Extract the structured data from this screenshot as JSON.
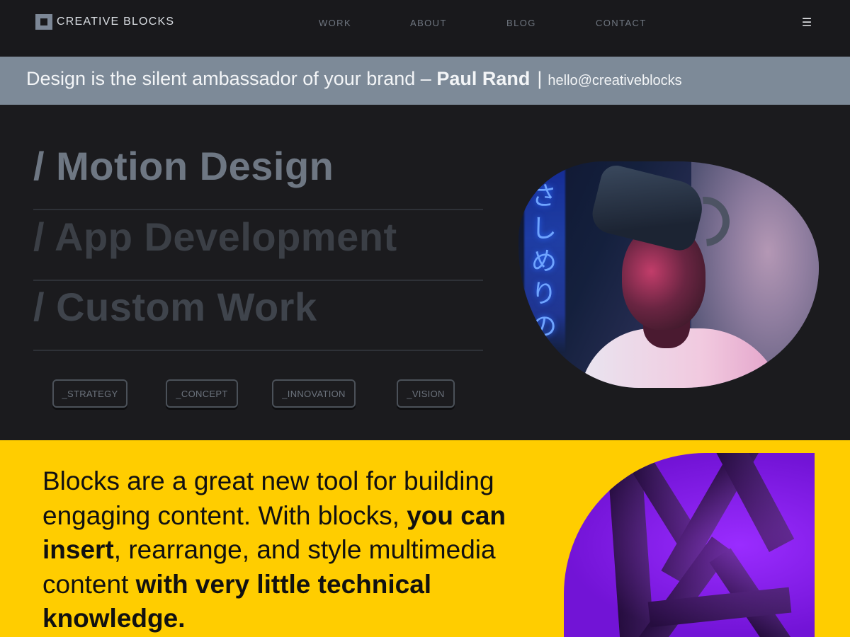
{
  "nav": {
    "logo": "CREATIVE BLOCKS",
    "links": [
      "WORK",
      "ABOUT",
      "BLOG",
      "CONTACT"
    ],
    "menu_icon": "hamburger-icon"
  },
  "quote": {
    "text": "Design is the silent ambassador of your brand – ",
    "author": "Paul Rand",
    "separator": "|",
    "email": "hello@creativeblocks"
  },
  "hero": {
    "services": [
      "/ Motion Design",
      "/ App Development",
      "/ Custom Work"
    ],
    "tags": [
      "_STRATEGY",
      "_CONCEPT",
      "_INNOVATION",
      "_VISION"
    ],
    "neon_sign": "さしめりのし"
  },
  "feature": {
    "text_1": "Blocks are a great new tool for building engaging content. With blocks, ",
    "bold_1": "you can insert",
    "text_2": ", rearrange, and style multimedia content ",
    "bold_2": "with very little technical knowledge."
  },
  "colors": {
    "background": "#19191c",
    "quote_bar": "#7d8a98",
    "accent_yellow": "#ffcd00",
    "accent_purple": "#8a1cff"
  }
}
